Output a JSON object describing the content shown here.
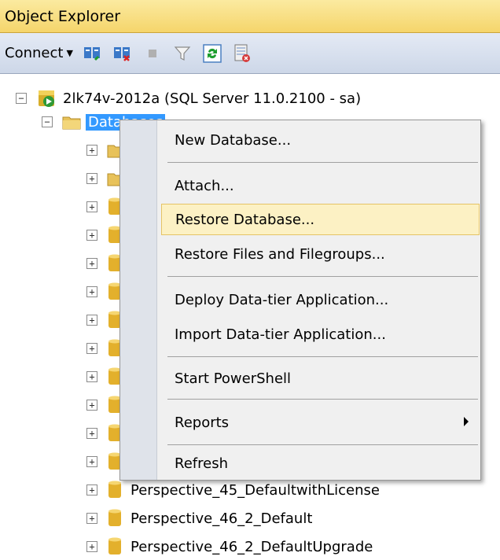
{
  "window": {
    "title": "Object Explorer"
  },
  "toolbar": {
    "connect_label": "Connect"
  },
  "tree": {
    "server": "2lk74v-2012a (SQL Server 11.0.2100 - sa)",
    "databases_folder": "Databases",
    "visible_db_items": [
      "Perspective_45_DefaultwithLicense",
      "Perspective_46_2_Default",
      "Perspective_46_2_DefaultUpgrade"
    ]
  },
  "context_menu": {
    "items": [
      {
        "label": "New Database..."
      },
      {
        "label": "Attach..."
      },
      {
        "label": "Restore Database..."
      },
      {
        "label": "Restore Files and Filegroups..."
      },
      {
        "label": "Deploy Data-tier Application..."
      },
      {
        "label": "Import Data-tier Application..."
      },
      {
        "label": "Start PowerShell"
      },
      {
        "label": "Reports"
      },
      {
        "label": "Refresh"
      }
    ]
  },
  "colors": {
    "selection": "#3399ff",
    "menu_highlight": "#fcf1c4",
    "title_bar": "#f5d56b"
  }
}
